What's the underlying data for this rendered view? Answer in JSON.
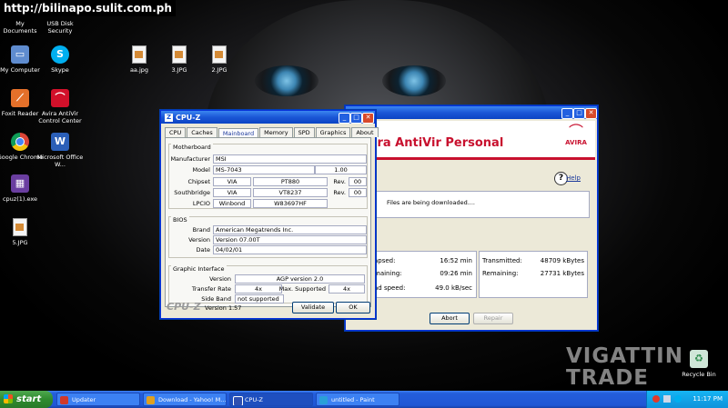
{
  "watermark": "http://bilinapo.sulit.com.ph",
  "desktop": {
    "top_labels": [
      "My Documents",
      "USB Disk Security"
    ],
    "icons": [
      {
        "label": "My Computer"
      },
      {
        "label": "Skype"
      },
      {
        "label": "aa.jpg"
      },
      {
        "label": "3.JPG"
      },
      {
        "label": "2.JPG"
      },
      {
        "label": "Foxit Reader"
      },
      {
        "label": "Avira AntiVir Control Center"
      },
      {
        "label": "Google Chrome"
      },
      {
        "label": "Microsoft Office W..."
      },
      {
        "label": "cpuz(1).exe"
      },
      {
        "label": "5.JPG"
      },
      {
        "label": "Recycle Bin"
      }
    ],
    "logo_watermark": [
      "VIGATTIN",
      "TRADE"
    ]
  },
  "cpuz": {
    "title": "CPU-Z",
    "tabs": [
      "CPU",
      "Caches",
      "Mainboard",
      "Memory",
      "SPD",
      "Graphics",
      "About"
    ],
    "active_tab": "Mainboard",
    "motherboard": {
      "group": "Motherboard",
      "manufacturer_label": "Manufacturer",
      "manufacturer": "MSI",
      "model_label": "Model",
      "model": "MS-7043",
      "model_rev": "1.00",
      "chipset_label": "Chipset",
      "chipset_vendor": "VIA",
      "chipset": "PT880",
      "chipset_rev_label": "Rev.",
      "chipset_rev": "00",
      "southbridge_label": "Southbridge",
      "southbridge_vendor": "VIA",
      "southbridge": "VT8237",
      "southbridge_rev_label": "Rev.",
      "southbridge_rev": "00",
      "lpcio_label": "LPCIO",
      "lpcio_vendor": "Winbond",
      "lpcio": "W83697HF"
    },
    "bios": {
      "group": "BIOS",
      "brand_label": "Brand",
      "brand": "American Megatrends Inc.",
      "version_label": "Version",
      "version": "Version 07.00T",
      "date_label": "Date",
      "date": "04/02/01"
    },
    "graphic": {
      "group": "Graphic Interface",
      "version_label": "Version",
      "version": "AGP version 2.0",
      "rate_label": "Transfer Rate",
      "rate": "4x",
      "max_label": "Max. Supported",
      "max": "4x",
      "sideband_label": "Side Band",
      "sideband": "not supported"
    },
    "footer": {
      "brand": "CPU-Z",
      "version": "Version 1.57",
      "validate": "Validate",
      "ok": "OK"
    }
  },
  "avira": {
    "title": "ira AntiVir Personal",
    "logo": "AVIRA",
    "help": "Help",
    "message": "Files are being downloaded....",
    "left_stats": [
      {
        "label": "apsed:",
        "value": "16:52 min"
      },
      {
        "label": "maining:",
        "value": "09:26 min"
      },
      {
        "label": "ad speed:",
        "value": "49.0 kB/sec"
      }
    ],
    "right_stats": [
      {
        "label": "Transmitted:",
        "value": "48709 kBytes"
      },
      {
        "label": "Remaining:",
        "value": "27731 kBytes"
      }
    ],
    "abort": "Abort",
    "repair": "Repair"
  },
  "taskbar": {
    "start": "start",
    "tasks": [
      "Updater",
      "Download - Yahoo! M...",
      "CPU-Z",
      "untitled - Paint"
    ],
    "clock": "11:17 PM",
    "colors": {
      "updater": "#d0392a",
      "download": "#e0a020",
      "cpuz": "#3050b0",
      "paint": "#2aa0d8"
    }
  }
}
